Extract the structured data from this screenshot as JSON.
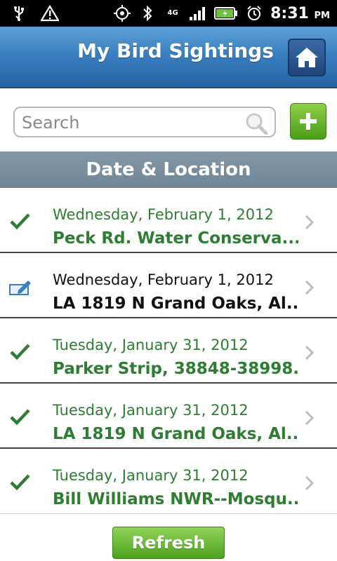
{
  "status_bar": {
    "time": "8:31",
    "ampm": "PM",
    "network": "4G",
    "icons": [
      "usb-icon",
      "warning-icon",
      "gps-icon",
      "bluetooth-icon",
      "signal-icon",
      "battery-icon",
      "alarm-icon"
    ]
  },
  "header": {
    "title": "My Bird Sightings",
    "home_icon": "home-icon"
  },
  "search": {
    "placeholder": "Search",
    "value": ""
  },
  "section": {
    "title": "Date & Location"
  },
  "colors": {
    "header_blue": "#2f6fb0",
    "synced_green": "#2e7d32",
    "button_green": "#5aae26",
    "section_gray": "#7a8e9e"
  },
  "sightings": [
    {
      "status": "synced",
      "status_icon": "check-icon",
      "date": "Wednesday, February 1, 2012",
      "location": "Peck Rd. Water Conserva..."
    },
    {
      "status": "draft",
      "status_icon": "edit-icon",
      "date": "Wednesday, February 1, 2012",
      "location": "LA 1819 N Grand Oaks, Al..."
    },
    {
      "status": "synced",
      "status_icon": "check-icon",
      "date": "Tuesday, January 31, 2012",
      "location": "Parker Strip, 38848-38998..."
    },
    {
      "status": "synced",
      "status_icon": "check-icon",
      "date": "Tuesday, January 31, 2012",
      "location": "LA 1819 N Grand Oaks, Al..."
    },
    {
      "status": "synced",
      "status_icon": "check-icon",
      "date": "Tuesday, January 31, 2012",
      "location": "Bill Williams NWR--Mosqu..."
    }
  ],
  "actions": {
    "refresh_label": "Refresh"
  }
}
